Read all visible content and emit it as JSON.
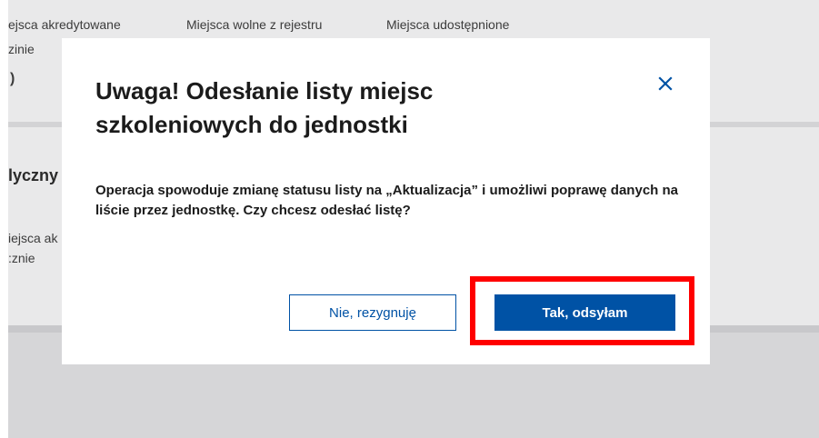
{
  "background": {
    "tabs": [
      "ejsca akredytowane",
      "Miejsca wolne z rejestru",
      "Miejsca udostępnione"
    ],
    "line_1": "zinie",
    "line_2": ")",
    "section_heading": "lyczny",
    "label_1": "iejsca ak",
    "label_2": ":znie"
  },
  "modal": {
    "title": "Uwaga! Odesłanie listy miejsc szkoleniowych do jednostki",
    "body": "Operacja spowoduje zmianę statusu listy na „Aktualizacja” i umożliwi poprawę danych na liście przez jednostkę. Czy chcesz odesłać listę?",
    "cancel_label": "Nie, rezygnuję",
    "confirm_label": "Tak, odsyłam",
    "close_icon": "close-icon"
  },
  "colors": {
    "primary": "#0052a5",
    "highlight": "#ff0000",
    "overlay": "#e9e9ea"
  }
}
